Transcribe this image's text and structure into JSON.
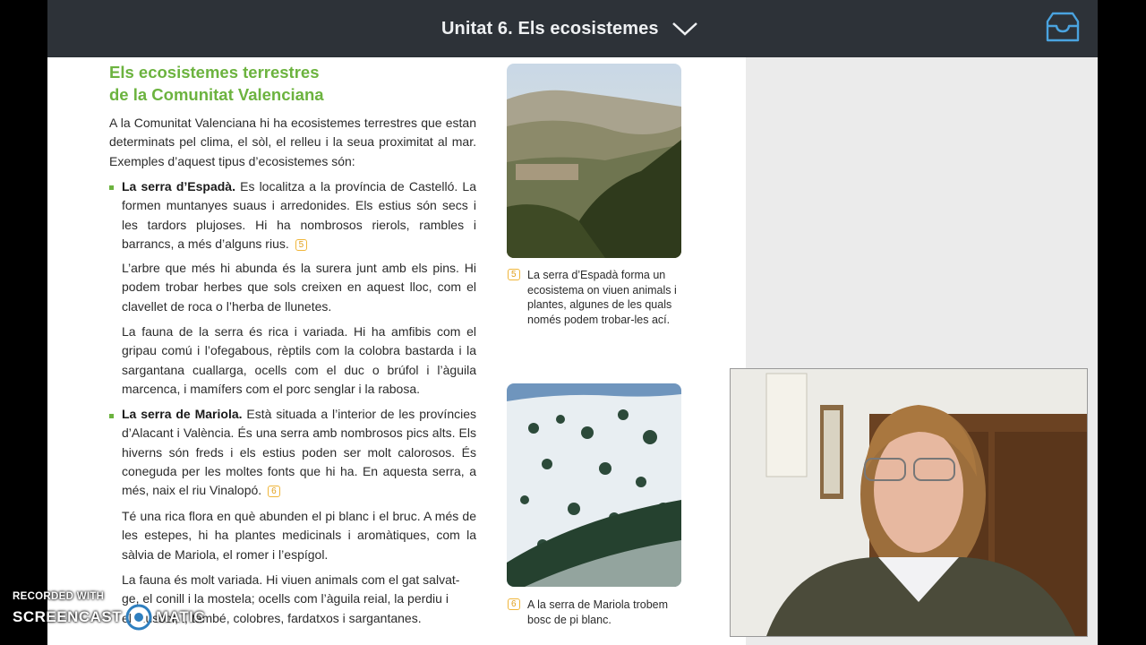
{
  "topbar": {
    "title": "Unitat 6. Els ecosistemes",
    "title_menu_icon": "chevron-down-icon",
    "inbox_icon": "inbox-tray-icon"
  },
  "page": {
    "heading_line1": "Els ecosistemes terrestres",
    "heading_line2": "de la Comunitat Valenciana",
    "intro": "A la Comunitat Valenciana hi ha ecosistemes terrestres que estan determinats pel clima, el sòl, el relleu i la seua proximitat al mar. Exemples d’aquest tipus d’ecosistemes són:",
    "espada": {
      "name": "La serra d’Espadà.",
      "text": "Es localitza a la província de Castelló. La formen muntanyes suaus i arredonides. Els estius són secs i les tardors plujoses. Hi ha nombrosos rierols, rambles i barrancs, a més d’alguns rius.",
      "ref": "5",
      "flora": "L’arbre que més hi abunda és la surera junt amb els pins. Hi podem trobar herbes que sols creixen en aquest lloc, com el clavellet de roca o l’herba de llunetes.",
      "fauna": "La fauna de la serra és rica i variada. Hi ha amfibis com el gripau comú i l’ofegabous, rèptils com la colobra bastarda i la sargantana cuallarga, ocells com el duc o brúfol i l’àguila marcenca, i mamífers com el porc senglar i la rabosa."
    },
    "mariola": {
      "name": "La serra de Mariola.",
      "text": "Està situada a l’interior de les províncies d’Alacant i València. És una serra amb nombrosos pics alts. Els hiverns són freds i els estius poden ser molt calorosos. És coneguda per les moltes fonts que hi ha. En aquesta serra, a més, naix el riu Vinalopó.",
      "ref": "6",
      "flora": "Té una rica flora en què abunden el pi blanc i el bruc. A més de les estepes, hi ha plantes medicinals i aromàtiques, com la sàlvia de Mariola, el romer i l’espígol.",
      "fauna_line1": "La fauna és molt variada. Hi viuen animals com el gat salvat-",
      "fauna_line2": "ge, el conill i la mostela; ocells com l’àguila reial, la perdiu i",
      "fauna_line3": "el mussol, i, també, colobres, fardatxos i sargantanes."
    },
    "caption5": {
      "ref": "5",
      "text": "La serra d’Espadà forma un ecosistema on viuen animals i plantes, algunes de les quals només podem trobar-les ací."
    },
    "caption6": {
      "ref": "6",
      "text": "A la serra de Mariola trobem bosc de pi blanc."
    }
  },
  "watermark": {
    "line1": "RECORDED WITH",
    "line2a": "SCREENCAST",
    "line2b": "MATIC"
  },
  "colors": {
    "topbar": "#2d3238",
    "heading_green": "#6cb33f",
    "ref_orange": "#f0b63a",
    "inbox_blue": "#4aa3df"
  }
}
